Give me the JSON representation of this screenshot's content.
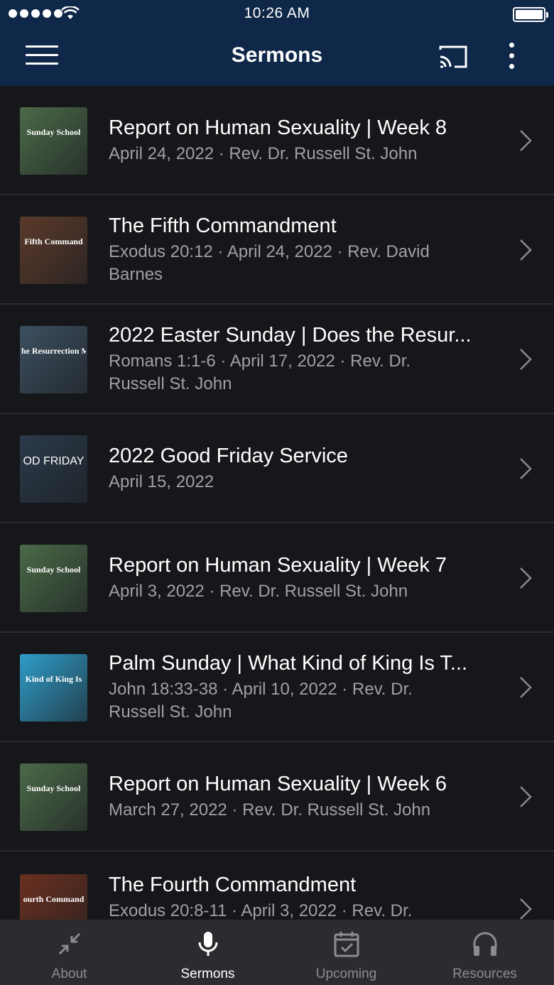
{
  "status_bar": {
    "time": "10:26 AM"
  },
  "nav": {
    "title": "Sermons"
  },
  "sermons": [
    {
      "title": "Report on Human Sexuality | Week 8",
      "meta": "April 24, 2022 · Rev. Dr. Russell St. John",
      "thumb_text": "Sunday School",
      "thumb_color": "#4a6a48"
    },
    {
      "title": "The Fifth Commandment",
      "meta": "Exodus 20:12 · April 24, 2022 · Rev. David Barnes",
      "thumb_text": "Fifth Command",
      "thumb_color": "#5a3a2a"
    },
    {
      "title": "2022 Easter Sunday | Does the Resur...",
      "meta": "Romans 1:1-6 · April 17, 2022 · Rev. Dr. Russell St. John",
      "thumb_text": "he Resurrection M",
      "thumb_color": "#3c5060"
    },
    {
      "title": "2022 Good Friday Service",
      "meta": "April 15, 2022",
      "thumb_text": "OD FRIDAY",
      "thumb_color": "#2a3a4a"
    },
    {
      "title": "Report on Human Sexuality | Week 7",
      "meta": "April 3, 2022 · Rev. Dr. Russell St. John",
      "thumb_text": "Sunday School",
      "thumb_color": "#4a6a48"
    },
    {
      "title": "Palm Sunday | What Kind of King Is T...",
      "meta": "John 18:33-38 · April 10, 2022 · Rev. Dr. Russell St. John",
      "thumb_text": "Kind of King Is",
      "thumb_color": "#2f9cc8"
    },
    {
      "title": "Report on Human Sexuality | Week 6",
      "meta": "March 27, 2022 · Rev. Dr. Russell St. John",
      "thumb_text": "Sunday School",
      "thumb_color": "#4a6a48"
    },
    {
      "title": "The Fourth Commandment",
      "meta": "Exodus 20:8-11 · April 3, 2022 · Rev. Dr.",
      "thumb_text": "ourth Command",
      "thumb_color": "#6a3020"
    }
  ],
  "tabs": [
    {
      "label": "About",
      "icon": "collapse-arrows-icon",
      "active": false
    },
    {
      "label": "Sermons",
      "icon": "microphone-icon",
      "active": true
    },
    {
      "label": "Upcoming",
      "icon": "calendar-check-icon",
      "active": false
    },
    {
      "label": "Resources",
      "icon": "headphones-icon",
      "active": false
    }
  ],
  "colors": {
    "header_bg": "#0f2748",
    "list_bg": "#16171a",
    "tabbar_bg": "#2b2c2f"
  }
}
